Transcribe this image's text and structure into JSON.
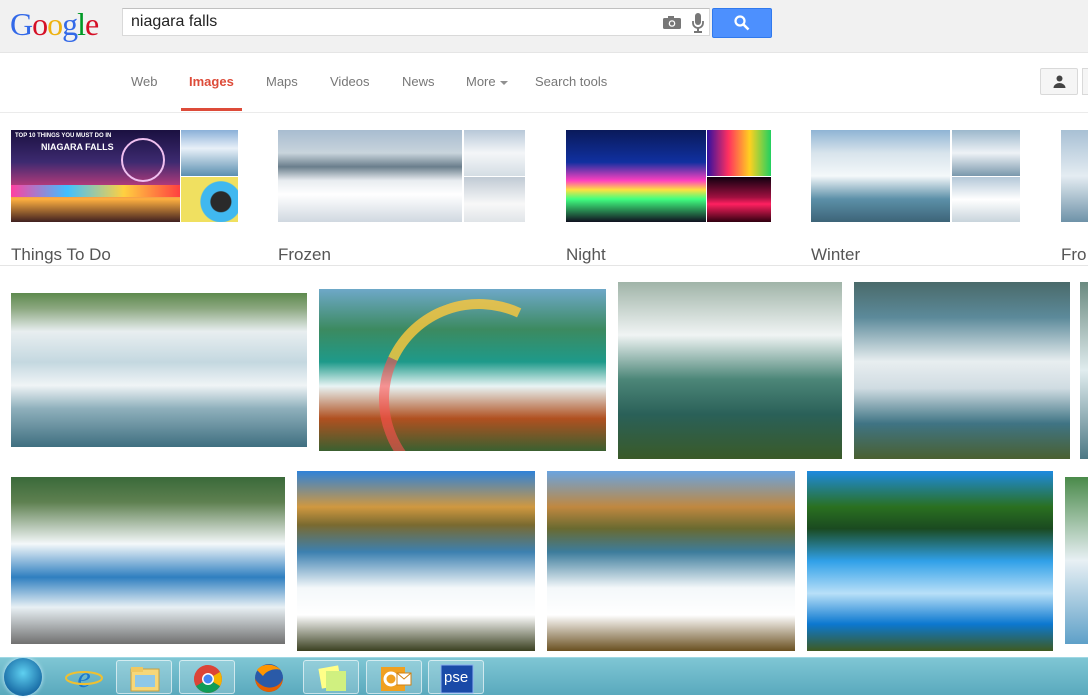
{
  "logo": {
    "letters": [
      "G",
      "o",
      "o",
      "g",
      "l",
      "e"
    ],
    "colors": [
      "#3369e8",
      "#d50f25",
      "#eeb211",
      "#3369e8",
      "#009925",
      "#d50f25"
    ]
  },
  "search": {
    "query": "niagara falls",
    "camera_icon": "camera-icon",
    "mic_icon": "microphone-icon",
    "button_icon": "search-icon"
  },
  "nav": {
    "tabs": [
      "Web",
      "Images",
      "Maps",
      "Videos",
      "News",
      "More",
      "Search tools"
    ],
    "active": "Images",
    "account_icon": "person-icon"
  },
  "related": [
    {
      "label": "Things To Do",
      "badge_line1": "TOP 10 THINGS YOU MUST DO IN",
      "badge_line2": "NIAGARA FALLS"
    },
    {
      "label": "Frozen"
    },
    {
      "label": "Night"
    },
    {
      "label": "Winter"
    },
    {
      "label": "Fro"
    }
  ],
  "results_count_row1": 5,
  "results_count_row2": 5,
  "taskbar": {
    "items": [
      "start-button",
      "internet-explorer-icon",
      "file-explorer-icon",
      "chrome-icon",
      "firefox-icon",
      "sticky-notes-icon",
      "outlook-icon",
      "photoshop-elements-icon"
    ],
    "pse_label": "pse"
  },
  "colors": {
    "accent": "#dd4b39",
    "search_button": "#4d90fe"
  }
}
